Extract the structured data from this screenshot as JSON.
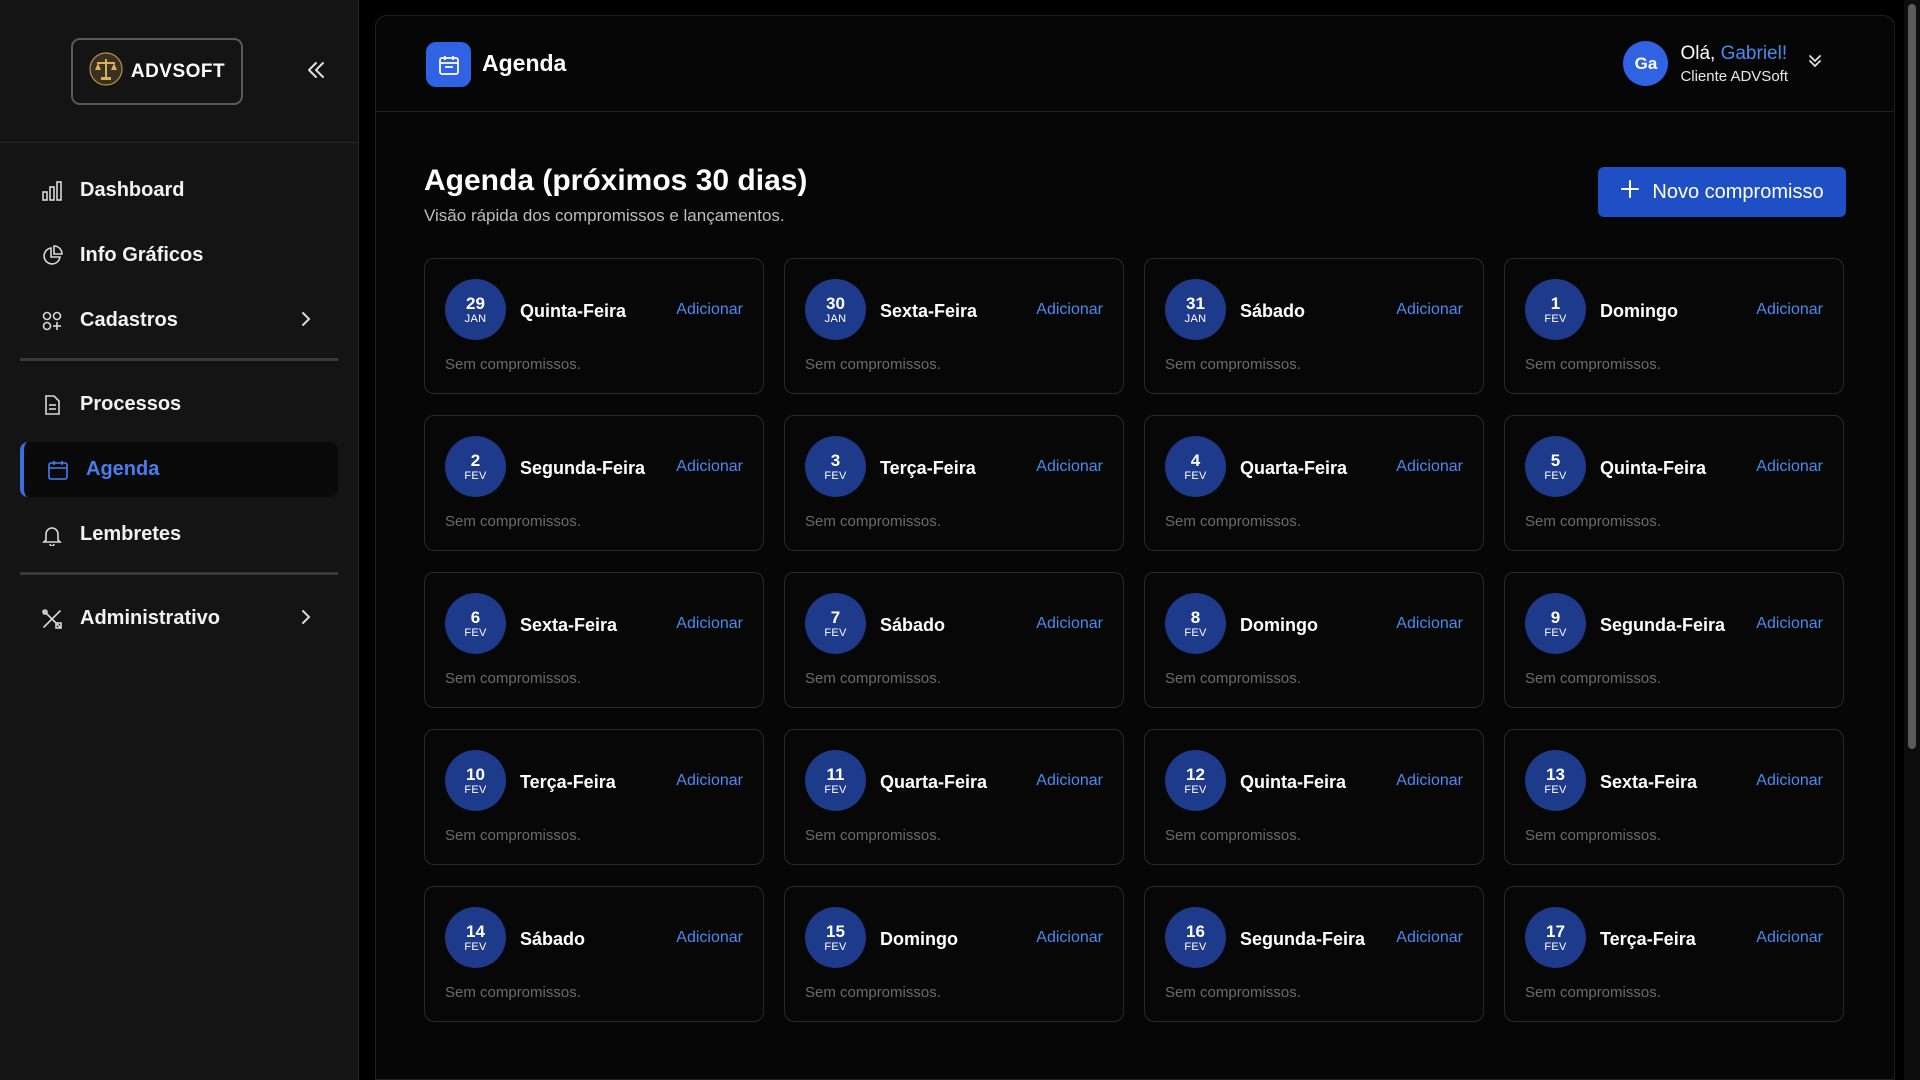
{
  "sidebar": {
    "logo_text": "ADVSOFT",
    "items": [
      {
        "label": "Dashboard"
      },
      {
        "label": "Info Gráficos"
      },
      {
        "label": "Cadastros"
      },
      {
        "label": "Processos"
      },
      {
        "label": "Agenda"
      },
      {
        "label": "Lembretes"
      },
      {
        "label": "Administrativo"
      }
    ]
  },
  "header": {
    "page_title": "Agenda",
    "avatar_initials": "Ga",
    "greeting": "Olá,",
    "user_name": "Gabriel!",
    "user_role": "Cliente ADVSoft"
  },
  "main": {
    "title": "Agenda (próximos 30 dias)",
    "subtitle": "Visão rápida dos compromissos e lançamentos.",
    "new_button_label": "Novo compromisso",
    "add_label": "Adicionar",
    "empty_label": "Sem compromissos.",
    "days": [
      {
        "day": "29",
        "month": "JAN",
        "weekday": "Quinta-Feira"
      },
      {
        "day": "30",
        "month": "JAN",
        "weekday": "Sexta-Feira"
      },
      {
        "day": "31",
        "month": "JAN",
        "weekday": "Sábado"
      },
      {
        "day": "1",
        "month": "FEV",
        "weekday": "Domingo"
      },
      {
        "day": "2",
        "month": "FEV",
        "weekday": "Segunda-Feira"
      },
      {
        "day": "3",
        "month": "FEV",
        "weekday": "Terça-Feira"
      },
      {
        "day": "4",
        "month": "FEV",
        "weekday": "Quarta-Feira"
      },
      {
        "day": "5",
        "month": "FEV",
        "weekday": "Quinta-Feira"
      },
      {
        "day": "6",
        "month": "FEV",
        "weekday": "Sexta-Feira"
      },
      {
        "day": "7",
        "month": "FEV",
        "weekday": "Sábado"
      },
      {
        "day": "8",
        "month": "FEV",
        "weekday": "Domingo"
      },
      {
        "day": "9",
        "month": "FEV",
        "weekday": "Segunda-Feira"
      },
      {
        "day": "10",
        "month": "FEV",
        "weekday": "Terça-Feira"
      },
      {
        "day": "11",
        "month": "FEV",
        "weekday": "Quarta-Feira"
      },
      {
        "day": "12",
        "month": "FEV",
        "weekday": "Quinta-Feira"
      },
      {
        "day": "13",
        "month": "FEV",
        "weekday": "Sexta-Feira"
      },
      {
        "day": "14",
        "month": "FEV",
        "weekday": "Sábado"
      },
      {
        "day": "15",
        "month": "FEV",
        "weekday": "Domingo"
      },
      {
        "day": "16",
        "month": "FEV",
        "weekday": "Segunda-Feira"
      },
      {
        "day": "17",
        "month": "FEV",
        "weekday": "Terça-Feira"
      }
    ]
  },
  "colors": {
    "accent": "#2f63e3",
    "date_circle": "#1e3a8a",
    "link": "#4a8af0"
  }
}
